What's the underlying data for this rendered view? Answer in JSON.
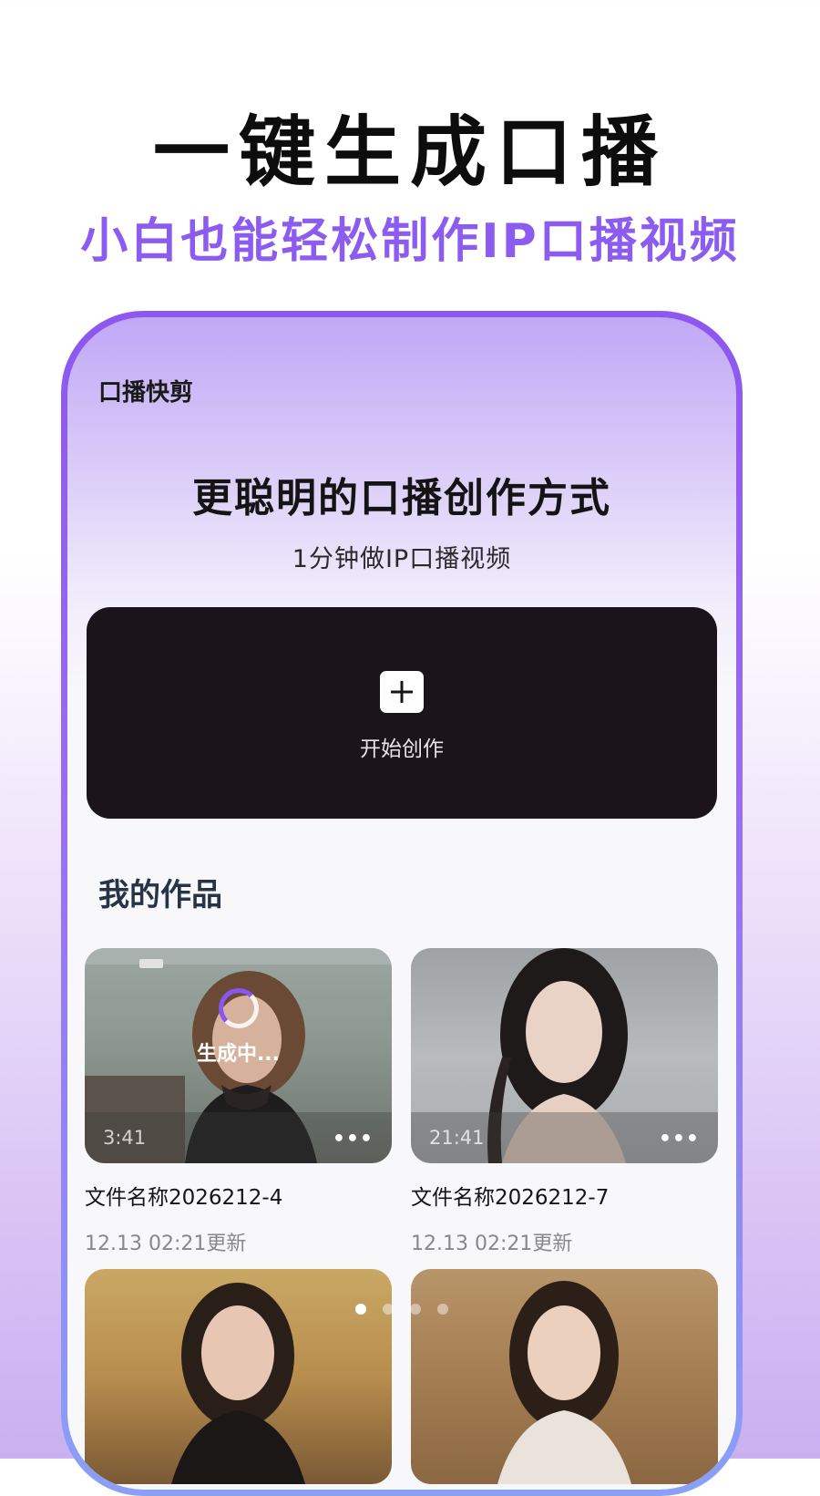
{
  "promo": {
    "headline": "一键生成口播",
    "subheadline": "小白也能轻松制作IP口播视频"
  },
  "app": {
    "name": "口播快剪",
    "title": "更聪明的口播创作方式",
    "subtitle": "1分钟做IP口播视频"
  },
  "create": {
    "label": "开始创作",
    "icon": "plus-icon"
  },
  "works": {
    "section_title": "我的作品",
    "items": [
      {
        "duration": "3:41",
        "status": "生成中...",
        "name": "文件名称2026212-4",
        "updated": "12.13 02:21更新"
      },
      {
        "duration": "21:41",
        "name": "文件名称2026212-7",
        "updated": "12.13 02:21更新"
      }
    ]
  },
  "pager": {
    "count": 4,
    "active_index": 0
  },
  "colors": {
    "accent": "#8c5cf0",
    "card_dark": "#1c141b",
    "frame": "#8d57f0"
  }
}
